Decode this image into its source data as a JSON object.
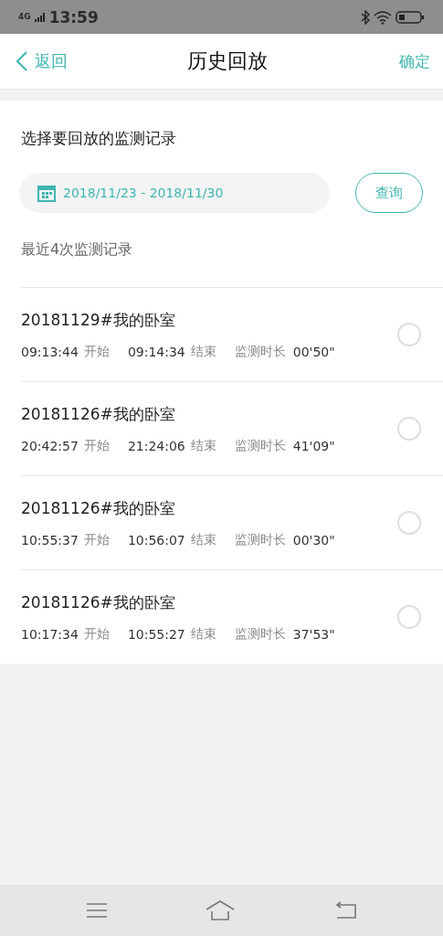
{
  "status_bar": {
    "network": "4G",
    "time": "13:59"
  },
  "header": {
    "back": "返回",
    "title": "历史回放",
    "confirm": "确定"
  },
  "section_title": "选择要回放的监测记录",
  "date_range": {
    "value": "2018/11/23 - 2018/11/30"
  },
  "query_button": "查询",
  "recent_title": "最近4次监测记录",
  "records": [
    {
      "name": "20181129#我的卧室",
      "start": "09:13:44",
      "start_label": "开始",
      "end": "09:14:34",
      "end_label": "结束",
      "duration_label": "监测时长",
      "duration": "00'50\"",
      "selected": false
    },
    {
      "name": "20181126#我的卧室",
      "start": "20:42:57",
      "start_label": "开始",
      "end": "21:24:06",
      "end_label": "结束",
      "duration_label": "监测时长",
      "duration": "41'09\"",
      "selected": false
    },
    {
      "name": "20181126#我的卧室",
      "start": "10:55:37",
      "start_label": "开始",
      "end": "10:56:07",
      "end_label": "结束",
      "duration_label": "监测时长",
      "duration": "00'30\"",
      "selected": false
    },
    {
      "name": "20181126#我的卧室",
      "start": "10:17:34",
      "start_label": "开始",
      "end": "10:55:27",
      "end_label": "结束",
      "duration_label": "监测时长",
      "duration": "37'53\"",
      "selected": false
    }
  ]
}
